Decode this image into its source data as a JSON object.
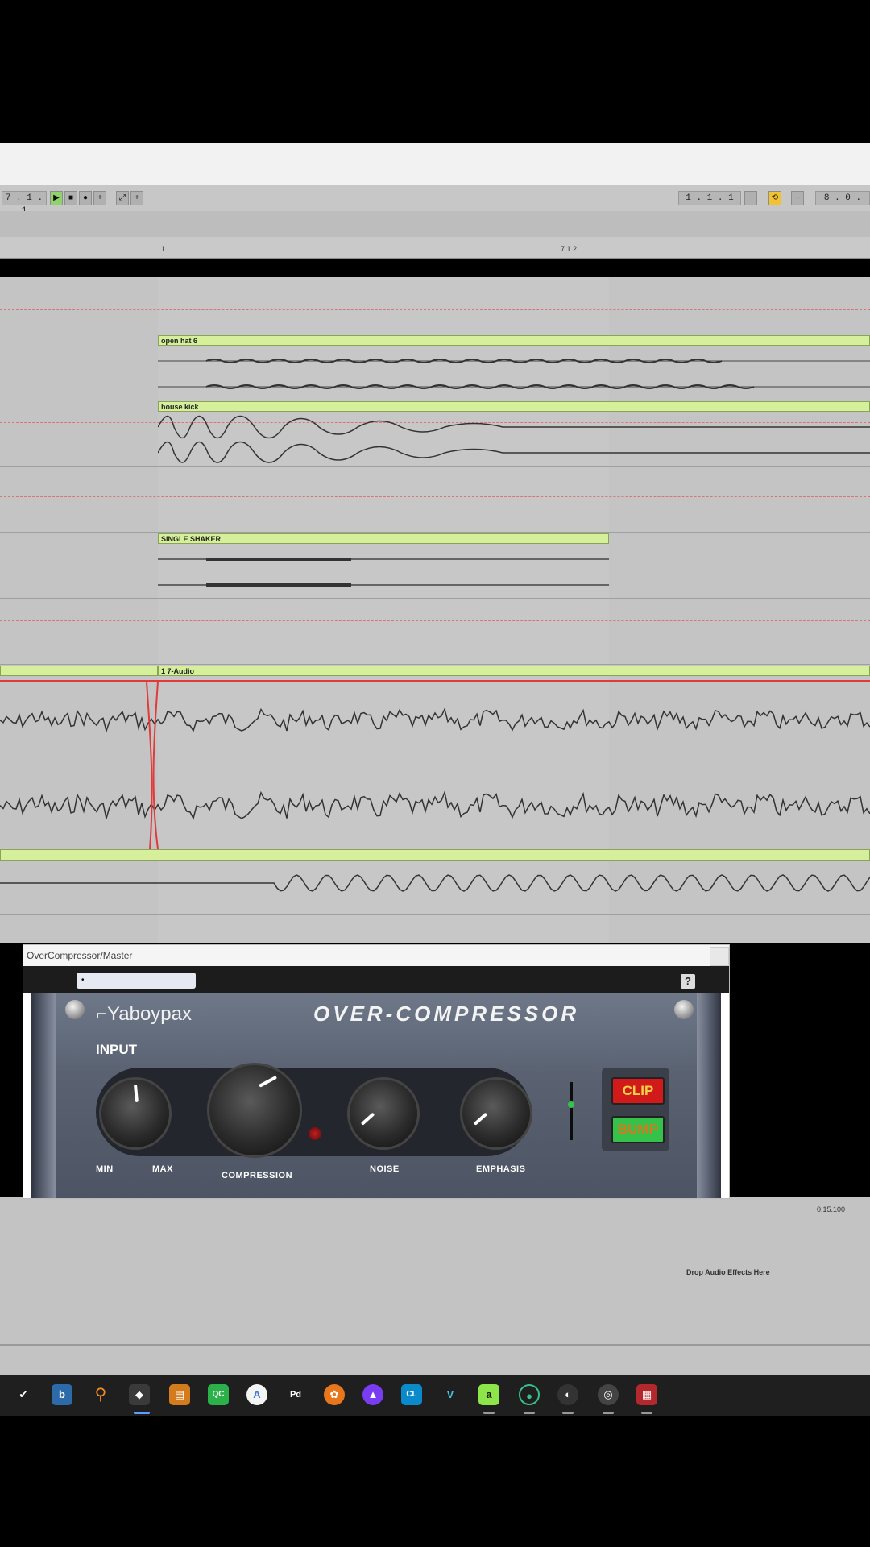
{
  "transport": {
    "position": "7 . 1 . 1",
    "loop_start": "1 . 1 . 1",
    "loop_length": "8 . 0 ."
  },
  "ruler": {
    "marker1": "1",
    "marker2": "7 1 2"
  },
  "clips": {
    "open_hat": "open hat 6",
    "house_kick": "house kick",
    "single_shaker": "SINGLE SHAKER",
    "audio": "1 7-Audio"
  },
  "plugin": {
    "window_title": "OverCompressor/Master",
    "preset": "•",
    "help": "?",
    "brand": "Yaboypax",
    "product": "OVER-COMPRESSOR",
    "input_label": "INPUT",
    "min_label": "MIN",
    "max_label": "MAX",
    "compression_label": "COMPRESSION",
    "noise_label": "NOISE",
    "emphasis_label": "EMPHASIS",
    "clip_label": "CLIP",
    "bump_label": "BUMP"
  },
  "lower": {
    "drop_text": "Drop Audio Effects Here",
    "time_readout": "0.15.100"
  },
  "taskbar": {
    "icons": [
      "checkmark-icon",
      "b-app-icon",
      "search-icon",
      "davinci-icon",
      "folder-app-icon",
      "qc-icon",
      "chrome-icon",
      "pd-icon",
      "fl-studio-icon",
      "affinity-icon",
      "clion-icon",
      "vs-icon",
      "ableton-icon",
      "green-circle-icon",
      "dark-app-icon",
      "obs-icon",
      "winrar-icon"
    ]
  },
  "colors": {
    "clip_green": "#d5ef9a",
    "clip_red": "#d31a1a",
    "bump_green": "#36c24a",
    "warp_red": "#e23a3a"
  }
}
